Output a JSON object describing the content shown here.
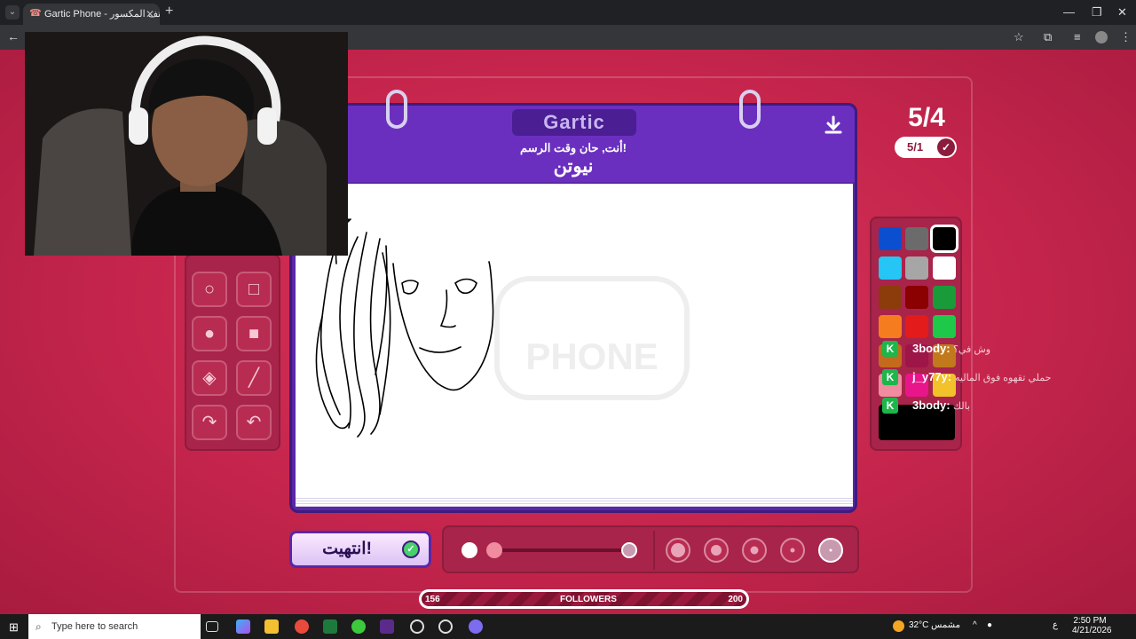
{
  "browser": {
    "tab_title": "Gartic Phone - الهاتف المكسور",
    "tab_icon": "☎"
  },
  "game": {
    "logo": "Gartic",
    "instruction": "أنت, حان وقت الرسم!",
    "word": "نيوتن",
    "round": "5/4",
    "sub_round": "5/1",
    "done_label": "انتهيت!",
    "watermark_line1": "Gartic",
    "watermark_line2": "PHONE"
  },
  "palette": {
    "colors": [
      "#0b4fd1",
      "#6b6b6b",
      "#000000",
      "#25c5f5",
      "#a6a6a6",
      "#ffffff",
      "#8c3c0b",
      "#8b0000",
      "#1a9b3a",
      "#f57c1f",
      "#e31b1b",
      "#1ec94a",
      "#c56a1c",
      "#9e1648",
      "#c2791b",
      "#f08ba0",
      "#e9158a",
      "#f2c22a"
    ],
    "selected": "#000000",
    "current": "#000000"
  },
  "followers": {
    "label": "FOLLOWERS",
    "current": "156",
    "goal": "200"
  },
  "chat": [
    {
      "user": "3body:",
      "msg": "وش في؟"
    },
    {
      "user": "j_y77y:",
      "msg": "حملي تقهوه فوق الماليه"
    },
    {
      "user": "3body:",
      "msg": "بالك"
    }
  ],
  "taskbar": {
    "search_placeholder": "Type here to search",
    "weather": "32°C مشمس",
    "lang": "ع",
    "time": "2:50 PM",
    "date": "4/21/2026"
  }
}
